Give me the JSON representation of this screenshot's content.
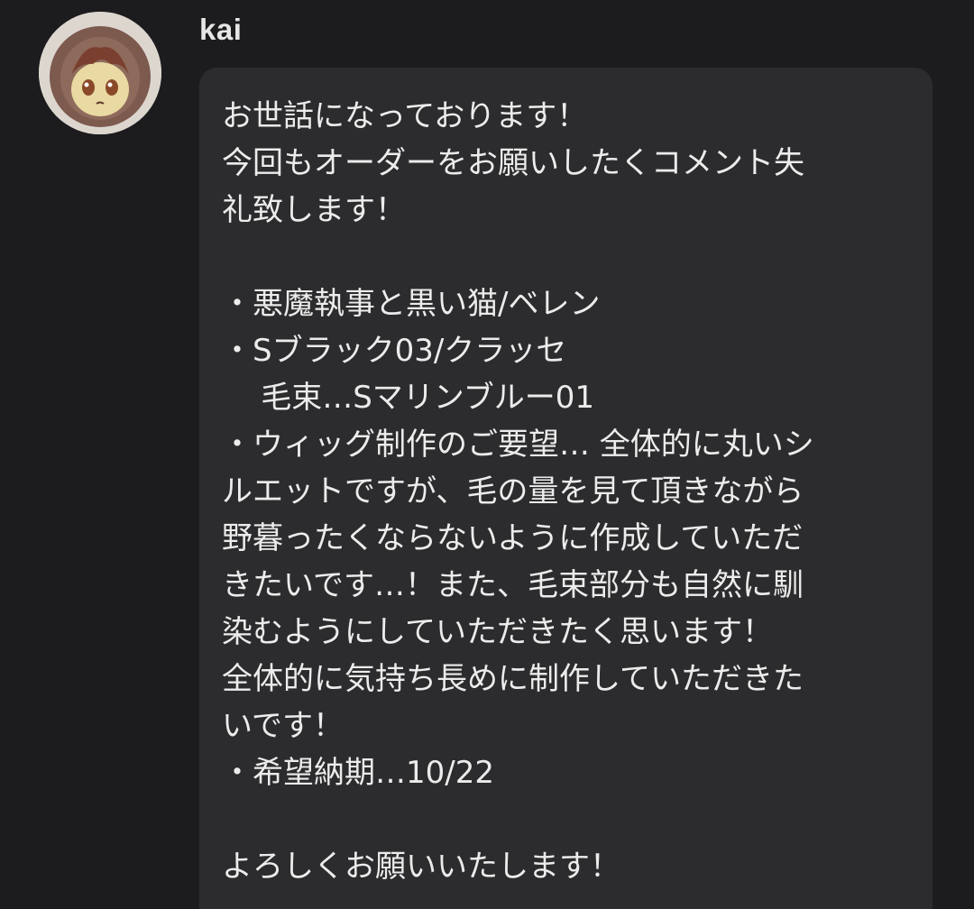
{
  "post": {
    "username": "kai",
    "avatar_icon": "plush-avatar-icon",
    "message_lines": [
      "お世話になっております！",
      "今回もオーダーをお願いしたくコメント失",
      "礼致します！",
      "",
      "・悪魔執事と黒い猫/ベレン",
      "・Sブラック03/クラッセ",
      "    毛束…Sマリンブルー01",
      "・ウィッグ制作のご要望… 全体的に丸いシ",
      "ルエットですが、毛の量を見て頂きながら",
      "野暮ったくならないように作成していただ",
      "きたいです…！また、毛束部分も自然に馴",
      "染むようにしていただきたく思います！",
      "全体的に気持ち長めに制作していただきた",
      "いです！",
      "・希望納期…10/22",
      "",
      "よろしくお願いいたします！"
    ]
  },
  "colors": {
    "background": "#1c1c1e",
    "bubble": "#2c2c2e",
    "text": "#ececec"
  }
}
